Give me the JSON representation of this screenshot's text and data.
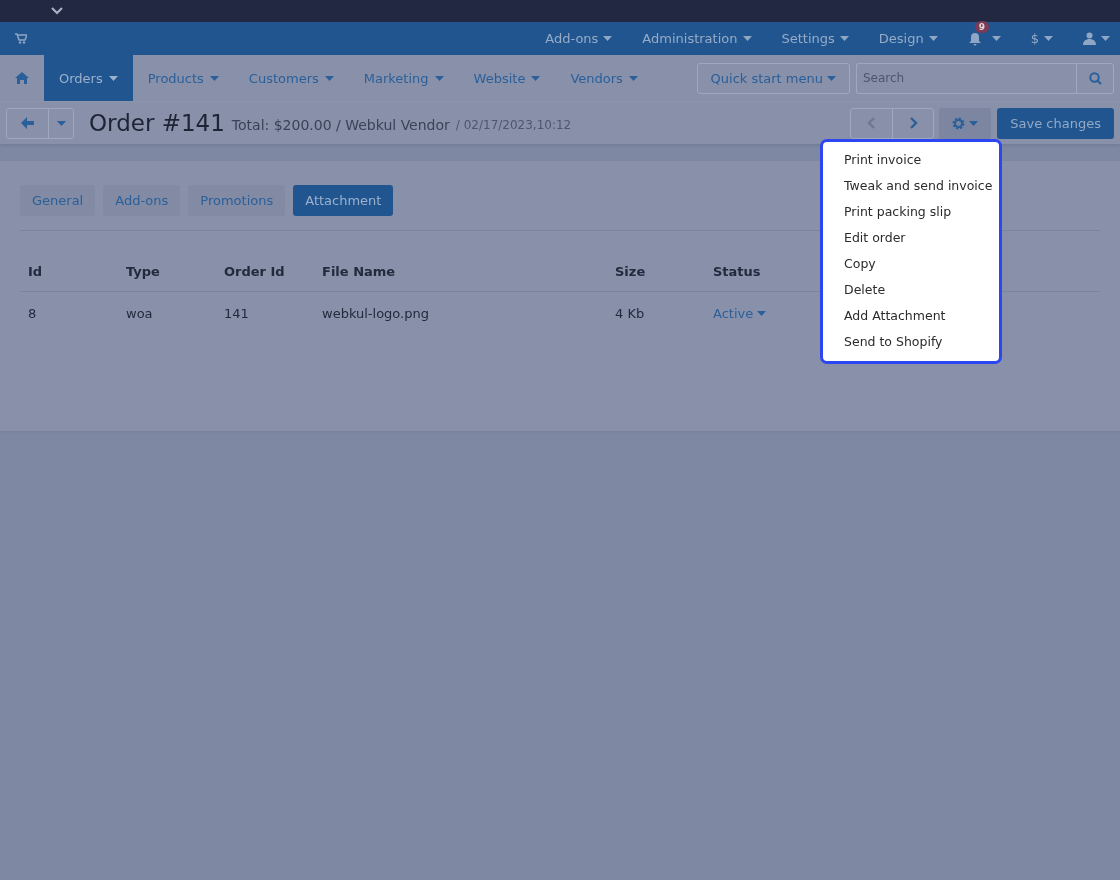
{
  "admin_bar": {
    "items": [
      {
        "label": "Add-ons"
      },
      {
        "label": "Administration"
      },
      {
        "label": "Settings"
      },
      {
        "label": "Design"
      }
    ],
    "notification_count": "9",
    "currency": "$"
  },
  "main_nav": {
    "items": [
      {
        "label": "Orders",
        "selected": true
      },
      {
        "label": "Products",
        "selected": false
      },
      {
        "label": "Customers",
        "selected": false
      },
      {
        "label": "Marketing",
        "selected": false
      },
      {
        "label": "Website",
        "selected": false
      },
      {
        "label": "Vendors",
        "selected": false
      }
    ],
    "quick_start": "Quick start menu",
    "search": {
      "placeholder": "Search"
    }
  },
  "header": {
    "title": "Order #141",
    "summary": "Total: $200.00 / Webkul Vendor",
    "date": "/ 02/17/2023,10:12",
    "pager": [
      {
        "kind": "prev",
        "disabled": true
      },
      {
        "kind": "next",
        "disabled": false
      }
    ],
    "save": "Save changes"
  },
  "tabs": [
    {
      "label": "General",
      "selected": false
    },
    {
      "label": "Add-ons",
      "selected": false
    },
    {
      "label": "Promotions",
      "selected": false
    },
    {
      "label": "Attachment",
      "selected": true
    }
  ],
  "table": {
    "columns": [
      "Id",
      "Type",
      "Order Id",
      "File Name",
      "Size",
      "Status"
    ],
    "rows": [
      {
        "cells": [
          "8",
          "woa",
          "141",
          "webkul-logo.png",
          "4 Kb"
        ],
        "status": "Active"
      }
    ]
  },
  "actions_menu": {
    "items": [
      "Print invoice",
      "Tweak and send invoice",
      "Print packing slip",
      "Edit order",
      "Copy",
      "Delete",
      "Add Attachment",
      "Send to Shopify"
    ]
  }
}
